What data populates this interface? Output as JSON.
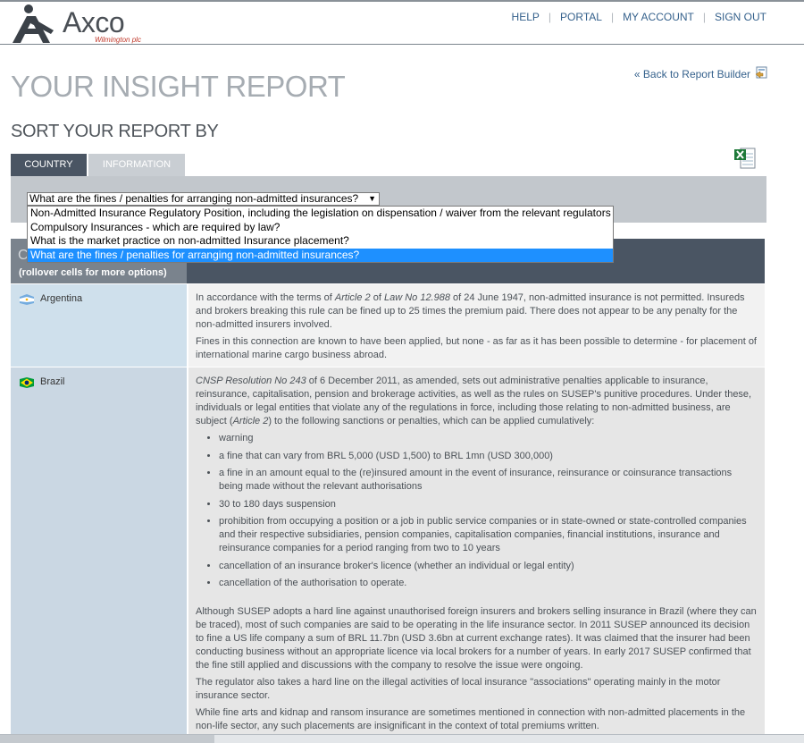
{
  "logo": {
    "name": "Axco",
    "sub": "Wilmington plc"
  },
  "nav": {
    "help": "HELP",
    "portal": "PORTAL",
    "account": "MY ACCOUNT",
    "signout": "SIGN OUT",
    "sep": "|"
  },
  "page": {
    "title": "YOUR INSIGHT REPORT",
    "back": "« Back to Report Builder",
    "sort_title": "SORT YOUR REPORT BY"
  },
  "tabs": {
    "country": "COUNTRY",
    "information": "INFORMATION"
  },
  "select": {
    "value": "What are the fines / penalties for arranging non-admitted insurances?",
    "options": [
      "Non-Admitted Insurance Regulatory Position, including the legislation on dispensation / waiver from the relevant regulators",
      "Compulsory Insurances - which are required by law?",
      "What is the market practice on non-admitted Insurance placement?",
      "What are the fines / penalties for arranging non-admitted insurances?"
    ]
  },
  "table": {
    "head_fragment": "C",
    "rollover_note": "(rollover cells for more options)"
  },
  "rows": {
    "argentina": {
      "name": "Argentina",
      "p1_a": "In accordance with the terms of ",
      "p1_em1": "Article 2",
      "p1_b": " of ",
      "p1_em2": "Law No 12.988",
      "p1_c": " of 24 June 1947, non-admitted insurance is not permitted. Insureds and brokers breaking this rule can be fined up to 25 times the premium paid. There does not appear to be any penalty for the non-admitted insurers involved.",
      "p2": "Fines in this connection are known to have been applied, but none - as far as it has been possible to determine - for placement of international marine cargo business abroad."
    },
    "brazil": {
      "name": "Brazil",
      "p1_em1": "CNSP Resolution No 243",
      "p1_a": " of 6 December 2011, as amended, sets out administrative penalties applicable to insurance, reinsurance, capitalisation, pension and brokerage activities, as well as the rules on SUSEP's punitive procedures. Under these, individuals or legal entities that violate any of the regulations in force, including those relating to non-admitted business, are subject (",
      "p1_em2": "Article 2",
      "p1_b": ") to the following sanctions or penalties, which can be applied cumulatively:",
      "bullets": [
        "warning",
        "a fine that can vary from BRL 5,000 (USD 1,500) to BRL 1mn (USD 300,000)",
        "a fine in an amount equal to the (re)insured amount in the event of insurance, reinsurance or coinsurance transactions being made without the relevant authorisations",
        "30 to 180 days suspension",
        "prohibition from occupying a position or a job in public service companies or in state-owned or state-controlled companies and their respective subsidiaries, pension companies, capitalisation companies, financial institutions, insurance and reinsurance companies for a period ranging from two to 10 years",
        "cancellation of an insurance broker's licence (whether an individual or legal entity)",
        "cancellation of the authorisation to operate."
      ],
      "p2": "Although SUSEP adopts a hard line against unauthorised foreign insurers and brokers selling insurance in Brazil (where they can be traced), most of such companies are said to be operating in the life insurance sector. In 2011 SUSEP announced its decision to fine a US life company a sum of BRL 11.7bn (USD 3.6bn at current exchange rates). It was claimed that the insurer had been conducting business without an appropriate licence via local brokers for a number of years. In early 2017 SUSEP confirmed that the fine still applied and discussions with the company to resolve the issue were ongoing.",
      "p3": "The regulator also takes a hard line on the illegal activities of local insurance \"associations\" operating mainly in the motor insurance sector.",
      "p4": "While fine arts and kidnap and ransom insurance are sometimes mentioned in connection with non-admitted placements in the non-life sector, any such placements are insignificant in the context of total premiums written."
    }
  }
}
